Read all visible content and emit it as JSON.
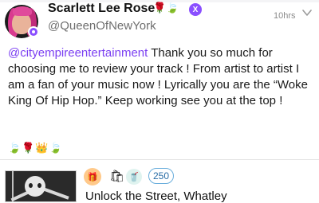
{
  "post": {
    "author": {
      "display_name": "Scarlett Lee Rose",
      "name_emojis": "🌹🍃",
      "verified_mark": "X",
      "handle": "@QueenOfNewYork"
    },
    "timestamp": "10hrs",
    "mention": "@cityempireentertainment",
    "body": " Thank you so much for choosing me to review your track ! From artist to artist I am a fan of your music now ! Lyrically you are the “Woke King Of Hip Hop.” Keep working see you at the top !",
    "reaction_emojis": "🍃🌹👑🍃"
  },
  "track": {
    "gift_emoji": "🎁",
    "bag_emoji": "🛍",
    "cup_emoji": "🥤",
    "reaction_count": "250",
    "title": "Unlock the Street, Whatley"
  },
  "colors": {
    "accent": "#7b3ff2",
    "badge_purple": "#8a4fff",
    "count_border": "#6aaedc"
  },
  "icons": [
    "avatar",
    "verified-badge-icon",
    "chevron-down-icon",
    "gift-icon",
    "present-icon",
    "cup-icon"
  ]
}
